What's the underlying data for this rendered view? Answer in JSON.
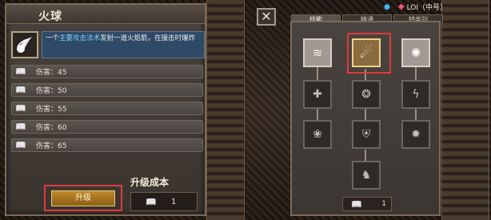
{
  "left": {
    "title": "火球",
    "desc_prefix": "一个",
    "desc_highlight": "主要攻击法术",
    "desc_suffix": "发射一道火焰箭，在撞击时爆炸",
    "rows": [
      {
        "label": "伤害：45"
      },
      {
        "label": "伤害：50"
      },
      {
        "label": "伤害：55"
      },
      {
        "label": "伤害：60"
      },
      {
        "label": "伤害：65"
      }
    ],
    "upgrade_label": "升级",
    "cost_title": "升级成本",
    "cost_value": "1"
  },
  "close_label": "✕",
  "tabs": [
    {
      "label": "技能"
    },
    {
      "label": "精通"
    },
    {
      "label": "特类别"
    }
  ],
  "top_info": {
    "server": "LOI（中号）"
  },
  "right_footer_count": "1",
  "icons": {
    "book": "book-icon",
    "fire": "fireball-icon"
  }
}
